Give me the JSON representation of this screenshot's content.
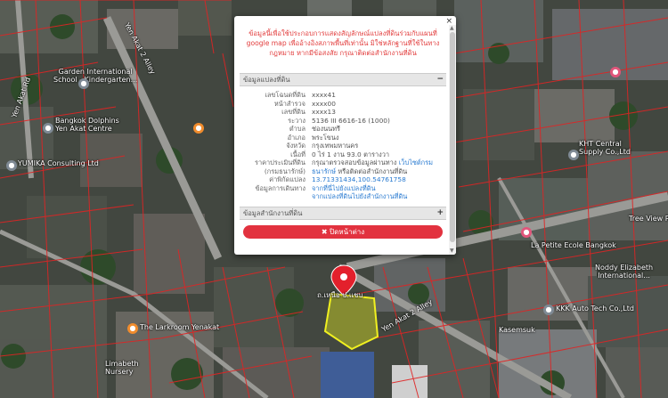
{
  "map": {
    "labels": {
      "yen_akat_2_alley_top": "Yen Akat 2 Alley",
      "yen_akat_rd": "Yen Akat Rd",
      "garden_school_1": "Garden International",
      "garden_school_2": "School - Kindergarten...",
      "bangkok_dolphins_1": "Bangkok Dolphins",
      "bangkok_dolphins_2": "Yen Akat Centre",
      "yumika": "YUMIKA Consulting Ltd",
      "kht_1": "KHT Central",
      "kht_2": "Supply Co.,Ltd",
      "tree_view": "Tree View Res",
      "yen_akat_2_alley_bottom": "Yen Akat 2 Alley",
      "larkroom": "The Larkroom Yenakat",
      "kkk": "KKK Auto Tech Co.,Ltd",
      "kasemsuk": "Kasemsuk",
      "la_petite": "La Petite Ecole Bangkok",
      "noddy_1": "Noddy Elizabeth",
      "noddy_2": "International...",
      "limabeth_1": "Limabeth",
      "limabeth_2": "Nursery",
      "parcel_marker": "ถ.เหนือ ป.แชบ"
    }
  },
  "popup": {
    "close_icon": "×",
    "notice": "ข้อมูลนี้เพื่อใช้ประกอบการแสดงสัญลักษณ์แปลงที่ดินร่วมกับแผนที่ google map เพื่ออ้างอิงสภาพพื้นที่เท่านั้น มิใช่หลักฐานที่ใช้ในทางกฎหมาย หากมีข้อสงสัย กรุณาติดต่อสำนักงานที่ดิน",
    "section_parcel": {
      "title": "ข้อมูลแปลงที่ดิน",
      "toggle": "−"
    },
    "rows": [
      {
        "key": "เลขโฉนดที่ดิน",
        "value": "xxxx41"
      },
      {
        "key": "หน้าสำรวจ",
        "value": "xxxx00"
      },
      {
        "key": "เลขที่ดิน",
        "value": "xxxx13"
      },
      {
        "key": "ระวาง",
        "value": "5136 III 6616-16 (1000)"
      },
      {
        "key": "ตำบล",
        "value": "ช่องนนทรี"
      },
      {
        "key": "อำเภอ",
        "value": "พระโขนง"
      },
      {
        "key": "จังหวัด",
        "value": "กรุงเทพมหานคร"
      },
      {
        "key": "เนื้อที่",
        "value": "0 ไร่ 1 งาน 93.0 ตารางวา"
      },
      {
        "key": "ราคาประเมินที่ดิน",
        "value": "กรุณาตรวจสอบข้อมูลผ่านทาง",
        "link": "เว็บไซต์กรม"
      },
      {
        "key": "(กรมธนารักษ์)",
        "value_link": "ธนารักษ์",
        "value": " หรือติดต่อสำนักงานที่ดิน"
      },
      {
        "key": "ค่าพิกัดแปลง",
        "link": "13.71331434,100.54761758"
      },
      {
        "key": "ข้อมูลการเดินทาง",
        "link": "จากที่นี่ไปยังแปลงที่ดิน"
      },
      {
        "key": "",
        "link": "จากแปลงที่ดินไปยังสำนักงานที่ดิน"
      }
    ],
    "section_office": {
      "title": "ข้อมูลสำนักงานที่ดิน",
      "toggle": "+"
    },
    "close_button": "✖ ปิดหน้าต่าง",
    "scroll_up": "▲",
    "scroll_down": "▼"
  }
}
